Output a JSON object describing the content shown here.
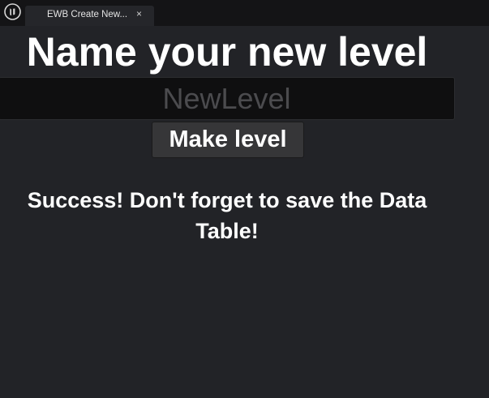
{
  "window": {
    "tab_label": "EWB Create New...",
    "tab_close_glyph": "×",
    "logo_icon": "unreal-engine-logo-icon"
  },
  "main": {
    "heading": "Name your new level",
    "name_input": {
      "value": "",
      "placeholder": "NewLevel"
    },
    "make_button_label": "Make level",
    "status_message": "Success!  Don't forget to save the Data Table!"
  }
}
